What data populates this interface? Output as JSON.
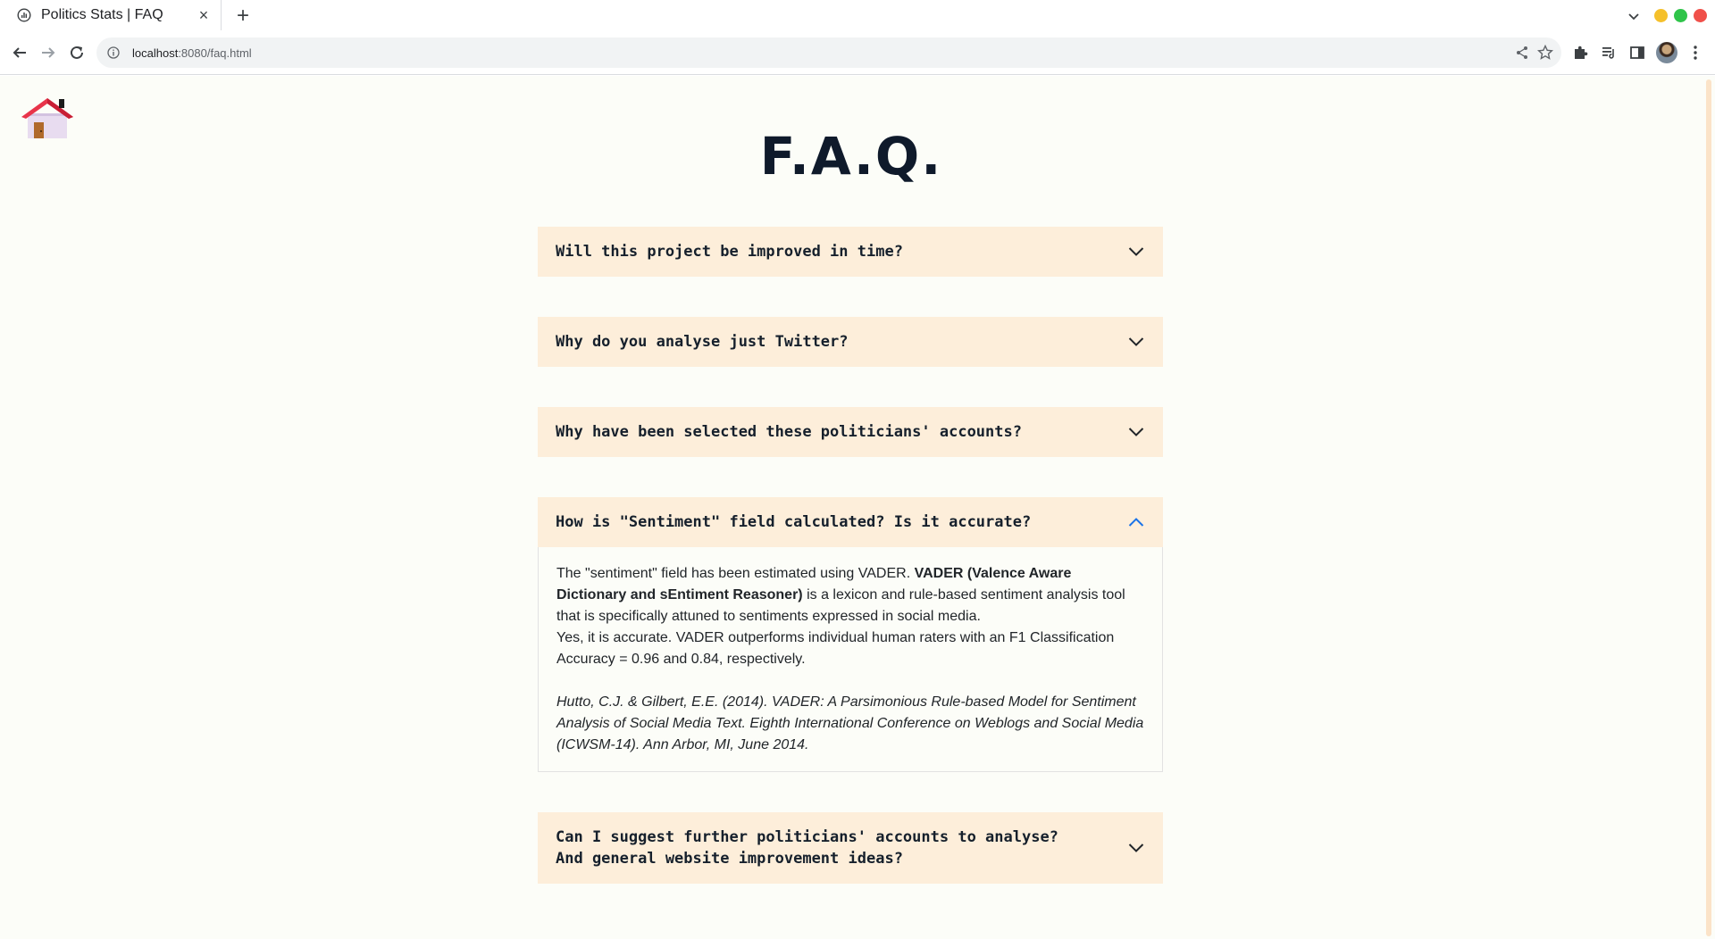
{
  "browser": {
    "tab_title": "Politics Stats | FAQ",
    "tab_close": "×",
    "new_tab": "+",
    "url_host": "localhost",
    "url_path": ":8080/faq.html"
  },
  "page": {
    "title": "F.A.Q.",
    "faq": [
      {
        "question": "Will this project be improved in time?",
        "expanded": false
      },
      {
        "question": "Why do you analyse just Twitter?",
        "expanded": false
      },
      {
        "question": "Why have been selected these politicians' accounts?",
        "expanded": false
      },
      {
        "question": "How is \"Sentiment\" field calculated? Is it accurate?",
        "expanded": true,
        "answer": {
          "intro": "The \"sentiment\" field has been estimated using VADER. ",
          "bold": "VADER (Valence Aware Dictionary and sEntiment Reasoner)",
          "rest": " is a lexicon and rule-based sentiment analysis tool that is specifically attuned to sentiments expressed in social media.",
          "accuracy": "Yes, it is accurate. VADER outperforms individual human raters with an F1 Classification Accuracy = 0.96 and 0.84, respectively.",
          "citation": "Hutto, C.J. & Gilbert, E.E. (2014). VADER: A Parsimonious Rule-based Model for Sentiment Analysis of Social Media Text. Eighth International Conference on Weblogs and Social Media (ICWSM-14). Ann Arbor, MI, June 2014."
        }
      },
      {
        "question": "Can I suggest further politicians' accounts to analyse?\nAnd general website improvement ideas?",
        "expanded": false
      }
    ]
  },
  "icons": {
    "favicon": "chart-icon",
    "home": "house-icon",
    "collapsed": "chevron-down-icon",
    "expanded": "chevron-up-icon"
  },
  "colors": {
    "faq_header_bg": "#fdeeda",
    "page_bg": "#fcfdf8",
    "title": "#0f1a2b",
    "chevron_active": "#1a73e8"
  }
}
